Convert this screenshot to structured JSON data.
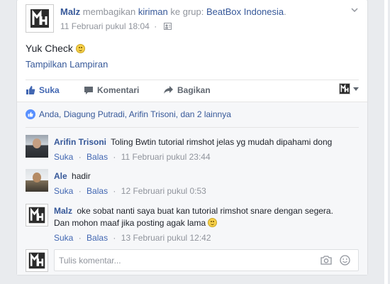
{
  "post": {
    "author": "Malz",
    "action_text": "membagikan",
    "object_text": "kiriman",
    "group_prefix": "ke grup:",
    "group": "BeatBox Indonesia",
    "group_suffix": ".",
    "timestamp": "11 Februari pukul 18:04",
    "timestamp_sep": "·",
    "text": "Yuk Check",
    "attachment_link": "Tampilkan Lampiran"
  },
  "actions": {
    "like": "Suka",
    "comment": "Komentari",
    "share": "Bagikan"
  },
  "likes_summary": {
    "names": "Anda, Diagung Putradi, Arifin Trisoni,",
    "connector": "dan",
    "others": "2 lainnya"
  },
  "comments": [
    {
      "author": "Arifin Trisoni",
      "text": "Toling Bwtin tutorial rimshot jelas yg mudah dipahami dong",
      "like": "Suka",
      "reply": "Balas",
      "time": "11 Februari pukul 23:44"
    },
    {
      "author": "Ale",
      "text": "hadir",
      "like": "Suka",
      "reply": "Balas",
      "time": "12 Februari pukul 0:53"
    },
    {
      "author": "Malz",
      "text_line1": "oke sobat nanti saya buat kan tutorial rimshot snare dengan segera.",
      "text_line2": "Dan mohon maaf jika posting agak lama",
      "like": "Suka",
      "reply": "Balas",
      "time": "13 Februari pukul 12:42"
    }
  ],
  "comment_input": {
    "placeholder": "Tulis komentar..."
  },
  "meta_separator": "·",
  "colors": {
    "link": "#365899",
    "like_blue": "#4267b2",
    "muted": "#90949c",
    "background": "#e9ebee"
  },
  "icons": [
    "privacy-icon",
    "chevron-down-icon",
    "like-icon",
    "comment-icon",
    "share-icon",
    "camera-icon",
    "emoji-icon"
  ]
}
